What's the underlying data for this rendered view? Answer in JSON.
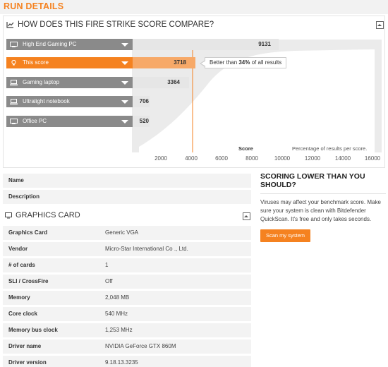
{
  "page": {
    "title": "RUN DETAILS"
  },
  "compare": {
    "heading": "HOW DOES THIS FIRE STRIKE SCORE COMPARE?",
    "bars": [
      {
        "label": "High End Gaming PC",
        "value": "9131",
        "icon": "desktop-icon",
        "highlight": false
      },
      {
        "label": "This score",
        "value": "3718",
        "icon": "lightbulb-icon",
        "highlight": true
      },
      {
        "label": "Gaming laptop",
        "value": "3364",
        "icon": "laptop-icon",
        "highlight": false
      },
      {
        "label": "Ultralight notebook",
        "value": "706",
        "icon": "laptop-icon",
        "highlight": false
      },
      {
        "label": "Office PC",
        "value": "520",
        "icon": "desktop-icon",
        "highlight": false
      }
    ],
    "callout": {
      "prefix": "Better than ",
      "percent": "34%",
      "suffix": " of all results"
    },
    "axis": {
      "score_label": "Score",
      "percentage_label": "Percentage of results per score.",
      "ticks": [
        "2000",
        "4000",
        "6000",
        "8000",
        "10000",
        "12000",
        "14000",
        "16000"
      ]
    },
    "colors": {
      "accent": "#f58220",
      "bar_gray": "#8a8a8a",
      "distribution": "#cfcfcf"
    }
  },
  "details": {
    "rows": [
      {
        "key": "Name",
        "value": ""
      },
      {
        "key": "Description",
        "value": ""
      }
    ]
  },
  "graphics_card": {
    "section_title": "GRAPHICS CARD",
    "rows": [
      {
        "key": "Graphics Card",
        "value": "Generic VGA"
      },
      {
        "key": "Vendor",
        "value": "Micro-Star International Co ., Ltd."
      },
      {
        "key": "# of cards",
        "value": "1"
      },
      {
        "key": "SLI / CrossFire",
        "value": "Off"
      },
      {
        "key": "Memory",
        "value": "2,048 MB"
      },
      {
        "key": "Core clock",
        "value": "540 MHz"
      },
      {
        "key": "Memory bus clock",
        "value": "1,253 MHz"
      },
      {
        "key": "Driver name",
        "value": "NVIDIA GeForce GTX 860M"
      },
      {
        "key": "Driver version",
        "value": "9.18.13.3235"
      }
    ]
  },
  "scoring": {
    "title": "SCORING LOWER THAN YOU SHOULD?",
    "text": "Viruses may affect your benchmark score. Make sure your system is clean with Bitdefender QuickScan. It's free and only takes seconds.",
    "button_label": "Scan my system"
  }
}
